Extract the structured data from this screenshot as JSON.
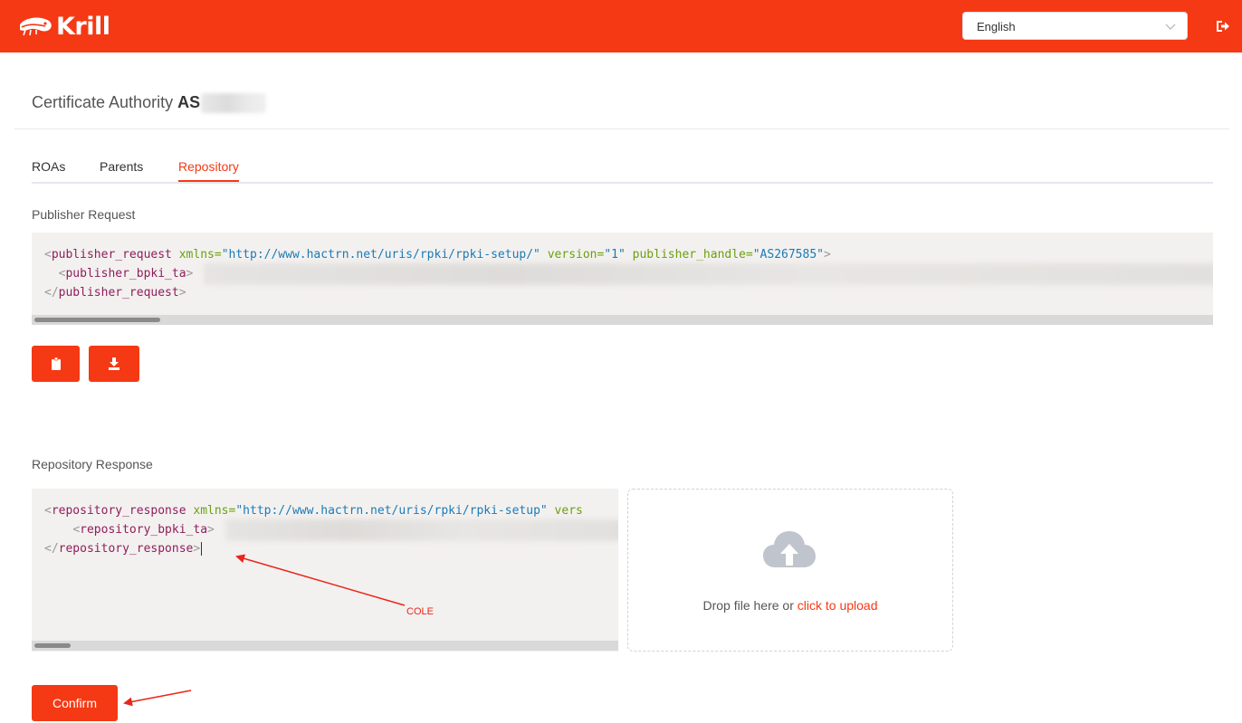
{
  "app": {
    "name": "Krill",
    "brand_color": "#f53914"
  },
  "header": {
    "language_select": {
      "value": "English"
    },
    "logout_icon": "sign-out-icon"
  },
  "page": {
    "title_prefix": "Certificate Authority",
    "title_handle_visible": "AS"
  },
  "tabs": [
    {
      "label": "ROAs",
      "active": false
    },
    {
      "label": "Parents",
      "active": false
    },
    {
      "label": "Repository",
      "active": true
    }
  ],
  "publisher_request": {
    "label": "Publisher Request",
    "line1": {
      "open": "<",
      "tag": "publisher_request",
      "attr1": " xmlns=",
      "val1": "\"http://www.hactrn.net/uris/rpki/rpki-setup/\"",
      "attr2": " version=",
      "val2": "\"1\"",
      "attr3": " publisher_handle=",
      "val3": "\"AS267585\"",
      "close": ">"
    },
    "line2": {
      "indent": "  ",
      "open": "<",
      "tag": "publisher_bpki_ta",
      "close": ">"
    },
    "line3": {
      "open": "</",
      "tag": "publisher_request",
      "close": ">"
    },
    "copy_icon": "clipboard-icon",
    "download_icon": "download-icon"
  },
  "repository_response": {
    "label": "Repository Response",
    "line1": {
      "open": "<",
      "tag": "repository_response",
      "attr1": " xmlns=",
      "val1": "\"http://www.hactrn.net/uris/rpki/rpki-setup\"",
      "attr2": " vers"
    },
    "line2": {
      "indent": "    ",
      "open": "<",
      "tag": "repository_bpki_ta",
      "close": ">"
    },
    "line3": {
      "open": "</",
      "tag": "repository_response",
      "close": ">"
    }
  },
  "upload": {
    "icon": "cloud-upload-icon",
    "text": "Drop file here or ",
    "link": "click to upload"
  },
  "annotation": {
    "label": "COLE",
    "color": "#e8261b"
  },
  "confirm_label": "Confirm"
}
